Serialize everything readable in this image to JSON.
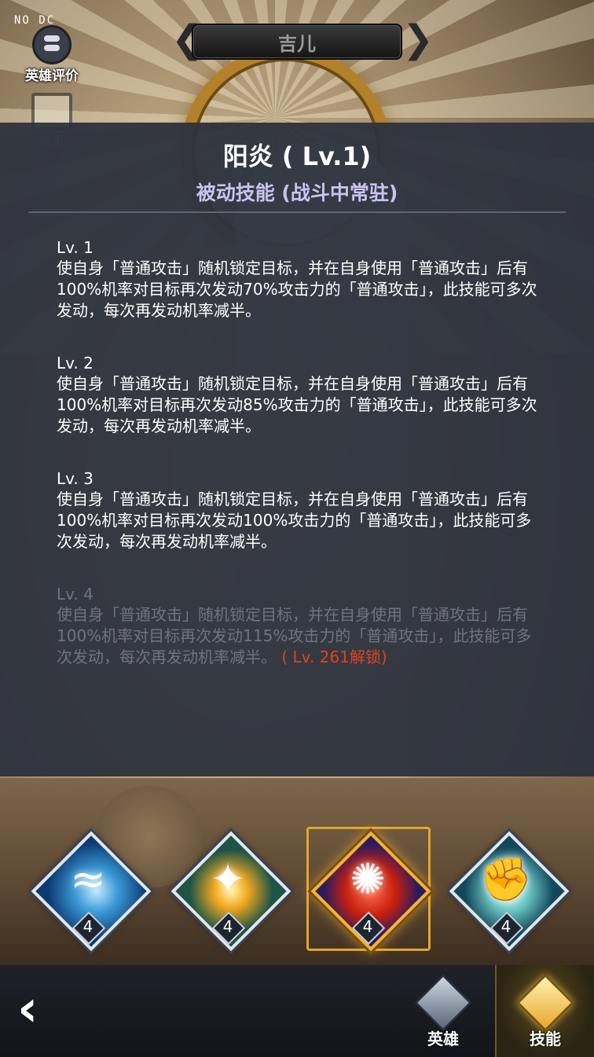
{
  "overlay": {
    "debug_text": "NO DC"
  },
  "side_menu": {
    "review_label": "英雄评价",
    "story_label": "故事"
  },
  "hero": {
    "name": "吉儿"
  },
  "skill": {
    "title": "阳炎 ( Lv.1)",
    "type": "被动技能 (战斗中常驻)",
    "levels": [
      {
        "label": "Lv. 1",
        "desc": "使自身「普通攻击」随机锁定目标，并在自身使用「普通攻击」后有100%机率对目标再次发动70%攻击力的「普通攻击」，此技能可多次发动，每次再发动机率减半。"
      },
      {
        "label": "Lv. 2",
        "desc": "使自身「普通攻击」随机锁定目标，并在自身使用「普通攻击」后有100%机率对目标再次发动85%攻击力的「普通攻击」，此技能可多次发动，每次再发动机率减半。"
      },
      {
        "label": "Lv. 3",
        "desc": "使自身「普通攻击」随机锁定目标，并在自身使用「普通攻击」后有100%机率对目标再次发动100%攻击力的「普通攻击」，此技能可多次发动，每次再发动机率减半。"
      },
      {
        "label": "Lv. 4",
        "desc": "使自身「普通攻击」随机锁定目标，并在自身使用「普通攻击」后有100%机率对目标再次发动115%攻击力的「普通攻击」，此技能可多次发动，每次再发动机率减半。",
        "unlock": "( Lv. 261解锁)"
      }
    ]
  },
  "skill_icons": [
    {
      "name": "water-wave-icon",
      "level": "4",
      "selected": false
    },
    {
      "name": "golden-star-icon",
      "level": "4",
      "selected": false
    },
    {
      "name": "red-blast-icon",
      "level": "4",
      "selected": true
    },
    {
      "name": "fist-icon",
      "level": "4",
      "selected": false
    }
  ],
  "bottom_nav": {
    "hero_label": "英雄",
    "skill_label": "技能",
    "active": "技能"
  },
  "colors": {
    "panel_bg": "#2c323d",
    "subtitle": "#c9c3f1",
    "unlock_text": "#e0421f",
    "locked_text": "#6e7480",
    "selected_frame": "#e4a52a"
  }
}
